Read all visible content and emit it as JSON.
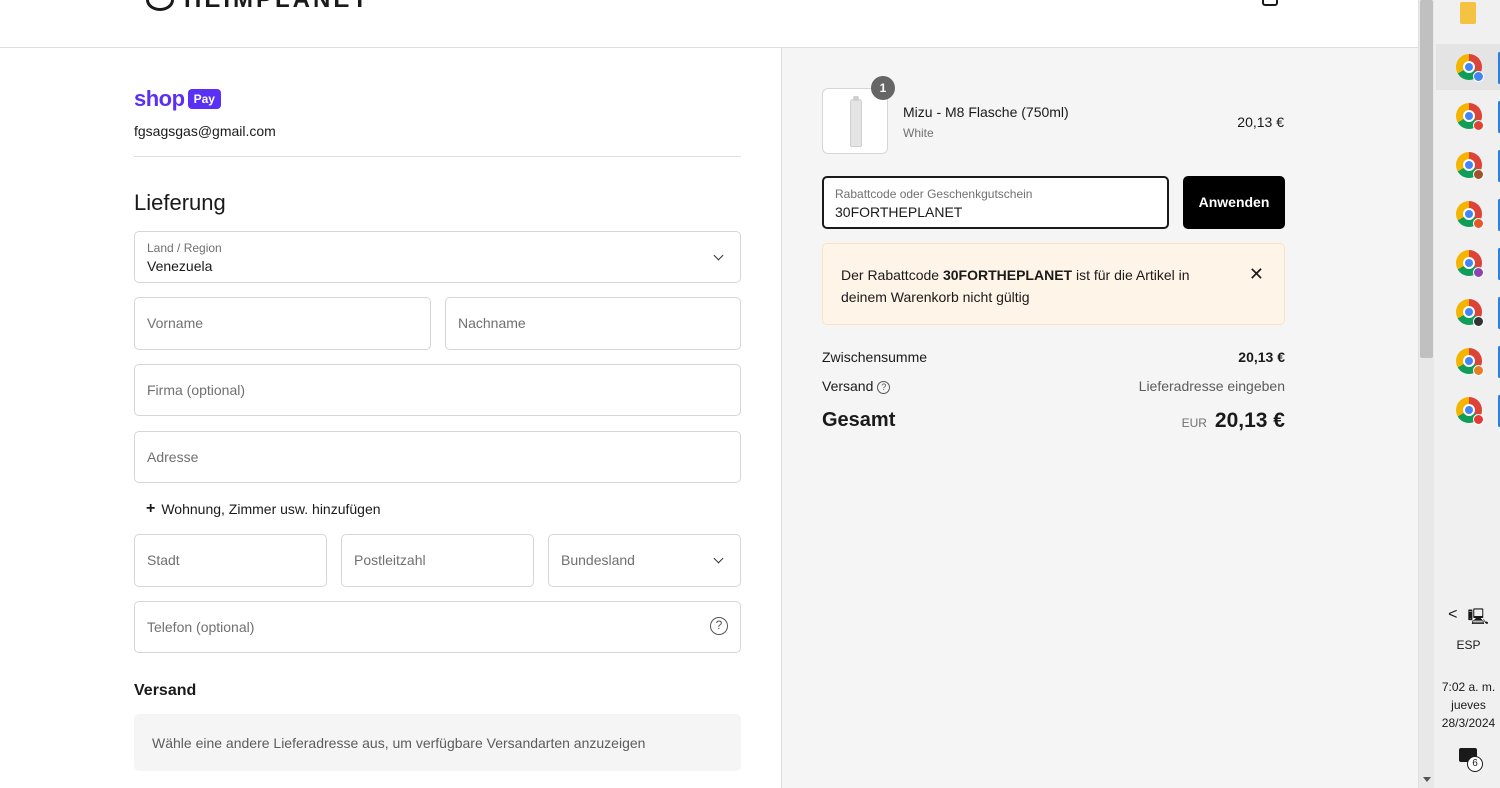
{
  "header": {
    "brand": "HEIMPLANET"
  },
  "shop_pay": {
    "shop": "shop",
    "pay": "Pay",
    "email": "fgsagsgas@gmail.com"
  },
  "delivery": {
    "title": "Lieferung",
    "country_label": "Land / Region",
    "country_value": "Venezuela",
    "first_name_ph": "Vorname",
    "last_name_ph": "Nachname",
    "company_ph": "Firma (optional)",
    "address_ph": "Adresse",
    "add_apartment": "Wohnung, Zimmer usw. hinzufügen",
    "city_ph": "Stadt",
    "postal_ph": "Postleitzahl",
    "state_ph": "Bundesland",
    "phone_ph": "Telefon (optional)"
  },
  "shipping": {
    "title": "Versand",
    "info": "Wähle eine andere Lieferadresse aus, um verfügbare Versandarten anzuzeigen"
  },
  "summary": {
    "product": {
      "qty": "1",
      "name": "Mizu - M8 Flasche (750ml)",
      "variant": "White",
      "price": "20,13 €"
    },
    "discount": {
      "label": "Rabattcode oder Geschenkgutschein",
      "value": "30FORTHEPLANET",
      "apply": "Anwenden",
      "error_pre": "Der Rabattcode ",
      "error_code": "30FORTHEPLANET",
      "error_post": " ist für die Artikel in deinem Warenkorb nicht gültig"
    },
    "subtotal_label": "Zwischensumme",
    "subtotal_value": "20,13 €",
    "shipping_label": "Versand",
    "shipping_value": "Lieferadresse eingeben",
    "total_label": "Gesamt",
    "total_currency": "EUR",
    "total_value": "20,13 €"
  },
  "taskbar": {
    "chrome_profile_colors": [
      "#4285f4",
      "#db4437",
      "#a0522d",
      "#e8562a",
      "#8e44ad",
      "#333333",
      "#e67e22",
      "#e53935"
    ],
    "tray_left": "<",
    "lang": "ESP",
    "time": "7:02 a. m.",
    "day": "jueves",
    "date": "28/3/2024",
    "notif_count": "6"
  }
}
